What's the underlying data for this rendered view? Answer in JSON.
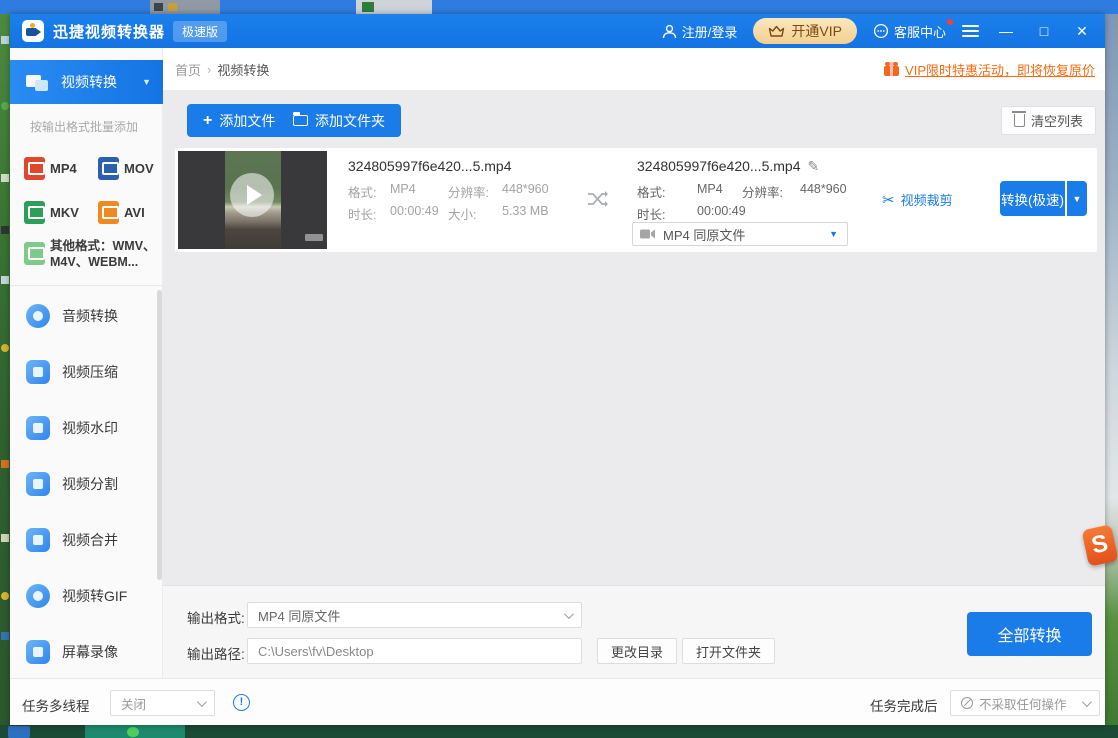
{
  "window": {
    "title": "迅捷视频转换器",
    "badge": "极速版",
    "login": "注册/登录",
    "vip_button": "开通VIP",
    "service": "客服中心",
    "minimize": "—",
    "maximize": "□",
    "close": "✕"
  },
  "breadcrumb": {
    "home": "首页",
    "separator": "›",
    "current": "视频转换"
  },
  "promo": {
    "text": "VIP限时特惠活动，即将恢复原价"
  },
  "toolbar": {
    "add_file": "添加文件",
    "add_folder": "添加文件夹",
    "clear_list": "清空列表"
  },
  "sidebar": {
    "active_label": "视频转换",
    "hint": "按输出格式批量添加",
    "formats": [
      {
        "label": "MP4",
        "color": "#e0482e"
      },
      {
        "label": "MOV",
        "color": "#2b5fb0"
      },
      {
        "label": "MKV",
        "color": "#2e9e5b"
      },
      {
        "label": "AVI",
        "color": "#f08a1e"
      }
    ],
    "other_line1": "其他格式：WMV、",
    "other_line2": "M4V、WEBM...",
    "items": [
      "音频转换",
      "视频压缩",
      "视频水印",
      "视频分割",
      "视频合并",
      "视频转GIF",
      "屏幕录像"
    ]
  },
  "file": {
    "src": {
      "name": "324805997f6e420...5.mp4",
      "format_label": "格式:",
      "format": "MP4",
      "resolution_label": "分辨率:",
      "resolution": "448*960",
      "duration_label": "时长:",
      "duration": "00:00:49",
      "size_label": "大小:",
      "size": "5.33 MB"
    },
    "out": {
      "name": "324805997f6e420...5.mp4",
      "format_label": "格式:",
      "format": "MP4",
      "resolution_label": "分辨率:",
      "resolution": "448*960",
      "duration_label": "时长:",
      "duration": "00:00:49",
      "preset": "MP4  同原文件"
    },
    "crop_link": "视频裁剪",
    "convert_button": "转换(极速)"
  },
  "output_panel": {
    "format_label": "输出格式:",
    "format_value": "MP4  同原文件",
    "path_label": "输出路径:",
    "path_value": "C:\\Users\\fv\\Desktop",
    "change_dir": "更改目录",
    "open_folder": "打开文件夹",
    "convert_all": "全部转换"
  },
  "status_bar": {
    "thread_label": "任务多线程",
    "thread_value": "关闭",
    "info": "!",
    "after_label": "任务完成后",
    "after_value": "不采取任何操作"
  },
  "icons": {
    "plus": "+",
    "pencil": "✎",
    "scissors": "✂",
    "caret_down": "▼",
    "s_logo": "S"
  },
  "colors": {
    "titlebar_blue": "#1677e8",
    "accent_blue": "#1a7ce8",
    "promo_orange": "#f96a10",
    "vip_gold_bg": "#f2cf90",
    "vip_gold_text": "#7a4a10",
    "content_gray": "#ebebee",
    "badge_orange": "#e8501e"
  }
}
